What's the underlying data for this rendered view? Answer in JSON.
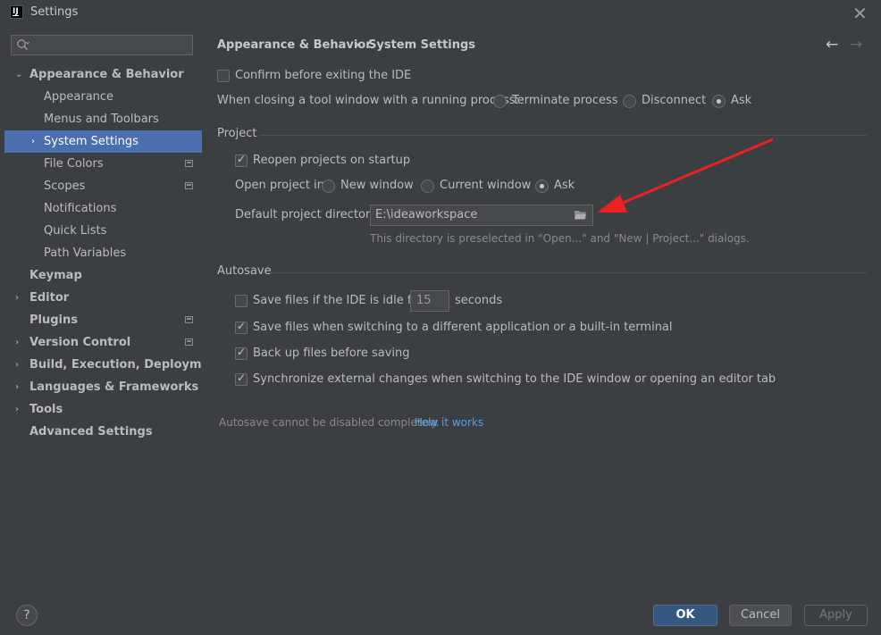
{
  "window": {
    "title": "Settings",
    "logo_text": "IJ",
    "close_glyph": "✕"
  },
  "sidebar": {
    "search_placeholder": "",
    "items": [
      {
        "label": "Appearance & Behavior",
        "expanded": true
      },
      {
        "label": "Appearance"
      },
      {
        "label": "Menus and Toolbars"
      },
      {
        "label": "System Settings",
        "selected": true
      },
      {
        "label": "File Colors"
      },
      {
        "label": "Scopes"
      },
      {
        "label": "Notifications"
      },
      {
        "label": "Quick Lists"
      },
      {
        "label": "Path Variables"
      },
      {
        "label": "Keymap"
      },
      {
        "label": "Editor"
      },
      {
        "label": "Plugins"
      },
      {
        "label": "Version Control"
      },
      {
        "label": "Build, Execution, Deployment"
      },
      {
        "label": "Languages & Frameworks"
      },
      {
        "label": "Tools"
      },
      {
        "label": "Advanced Settings"
      }
    ]
  },
  "breadcrumb": {
    "parent": "Appearance & Behavior",
    "separator": "›",
    "current": "System Settings",
    "back_glyph": "←",
    "forward_glyph": "→"
  },
  "general": {
    "confirm_exit": {
      "label": "Confirm before exiting the IDE",
      "checked": false
    },
    "close_tool_window": {
      "label": "When closing a tool window with a running process:",
      "options": [
        "Terminate process",
        "Disconnect",
        "Ask"
      ],
      "selected": "Ask"
    }
  },
  "project": {
    "header": "Project",
    "reopen": {
      "label": "Reopen projects on startup",
      "checked": true
    },
    "open_in": {
      "label": "Open project in",
      "options": [
        "New window",
        "Current window",
        "Ask"
      ],
      "selected": "Ask"
    },
    "default_dir": {
      "label": "Default project directory:",
      "value": "E:\\ideaworkspace",
      "hint": "This directory is preselected in \"Open...\" and \"New | Project...\" dialogs."
    }
  },
  "autosave": {
    "header": "Autosave",
    "idle": {
      "label": "Save files if the IDE is idle for",
      "value": "15",
      "suffix": "seconds",
      "checked": false
    },
    "switching": {
      "label": "Save files when switching to a different application or a built-in terminal",
      "checked": true
    },
    "backup": {
      "label": "Back up files before saving",
      "checked": true
    },
    "sync": {
      "label": "Synchronize external changes when switching to the IDE window or opening an editor tab",
      "checked": true
    },
    "note": "Autosave cannot be disabled completely.",
    "link": "How it works"
  },
  "footer": {
    "help": "?",
    "ok": "OK",
    "cancel": "Cancel",
    "apply": "Apply"
  },
  "colors": {
    "accent_selection": "#4b6eaf",
    "ok_button": "#365880",
    "annotation_arrow": "#e8231f",
    "link": "#589df6"
  }
}
